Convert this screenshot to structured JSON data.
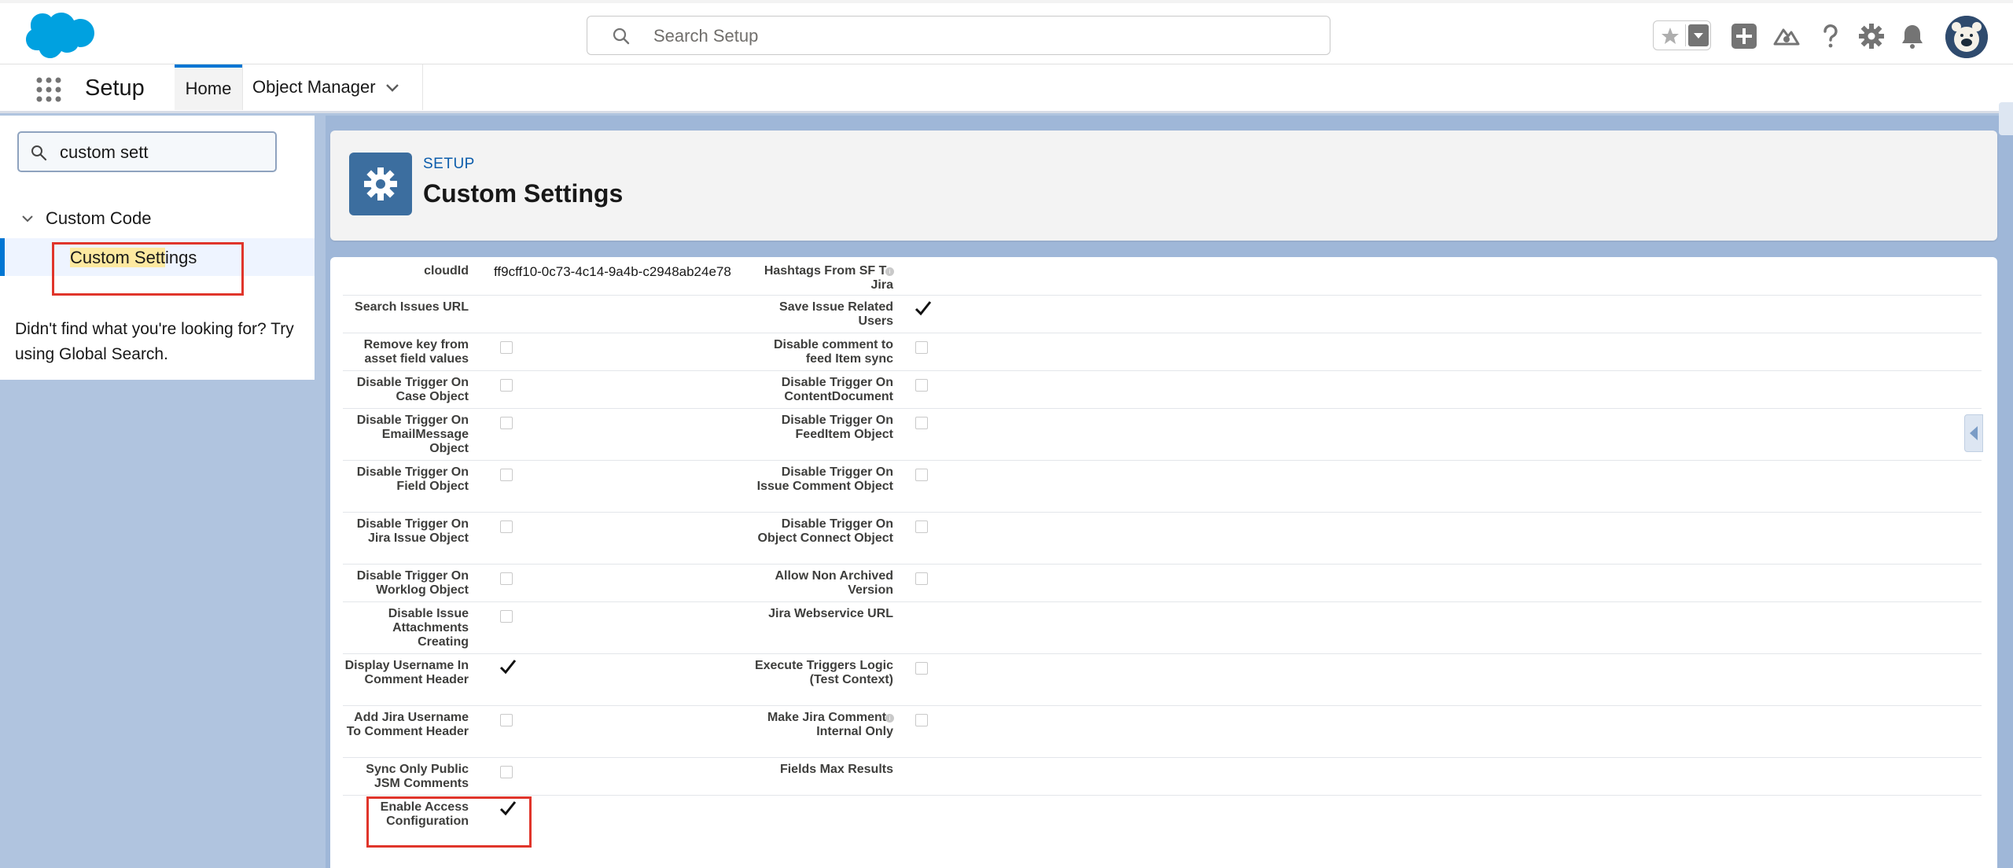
{
  "header": {
    "search_placeholder": "Search Setup",
    "icons": [
      "favorites-star-icon",
      "favorites-dropdown-icon",
      "global-actions-add-icon",
      "trailhead-guidance-icon",
      "help-icon",
      "setup-gear-icon",
      "notifications-bell-icon",
      "user-avatar"
    ]
  },
  "nav": {
    "app_name": "Setup",
    "tabs": [
      {
        "label": "Home"
      },
      {
        "label": "Object Manager"
      }
    ]
  },
  "sidebar": {
    "quickfind_value": "custom sett",
    "tree_parent": "Custom Code",
    "tree_child_match": "Custom Sett",
    "tree_child_rest": "ings",
    "not_found": "Didn't find what you're looking for? Try using Global Search."
  },
  "page_header": {
    "eyebrow": "SETUP",
    "title": "Custom Settings"
  },
  "fields": {
    "r1": {
      "left_label": "cloudId",
      "left_value": "ff9cff10-0c73-4c14-9a4b-c2948ab24e78",
      "right_label": "Hashtags From SF To Jira",
      "right_checked": false
    },
    "r2": {
      "left_label": "Search Issues URL",
      "right_label": "Save Issue Related Users",
      "right_checked": true
    },
    "r3": {
      "left_label": "Remove key from asset field values",
      "left_checked": false,
      "right_label": "Disable comment to feed Item sync",
      "right_checked": false
    },
    "r4": {
      "left_label": "Disable Trigger On Case Object",
      "left_checked": false,
      "right_label": "Disable Trigger On ContentDocument",
      "right_checked": false
    },
    "r5": {
      "left_label": "Disable Trigger On EmailMessage Object",
      "left_checked": false,
      "right_label": "Disable Trigger On FeedItem Object",
      "right_checked": false
    },
    "r6": {
      "left_label": "Disable Trigger On Field Object",
      "left_checked": false,
      "right_label": "Disable Trigger On Issue Comment Object",
      "right_checked": false
    },
    "r7": {
      "left_label": "Disable Trigger On Jira Issue Object",
      "left_checked": false,
      "right_label": "Disable Trigger On Object Connect Object",
      "right_checked": false
    },
    "r8": {
      "left_label": "Disable Trigger On Worklog Object",
      "left_checked": false,
      "right_label": "Allow Non Archived Version",
      "right_checked": false
    },
    "r9": {
      "left_label": "Disable Issue Attachments Creating",
      "left_checked": false,
      "right_label": "Jira Webservice URL"
    },
    "r10": {
      "left_label": "Display Username In Comment Header",
      "left_checked": true,
      "right_label": "Execute Triggers Logic (Test Context)",
      "right_checked": false
    },
    "r11": {
      "left_label": "Add Jira Username To Comment Header",
      "left_checked": false,
      "right_label": "Make Jira Comments Internal Only",
      "right_checked": false
    },
    "r12": {
      "left_label": "Sync Only Public JSM Comments",
      "left_checked": false,
      "right_label": "Fields Max Results"
    },
    "r13": {
      "left_label": "Enable Access Configuration",
      "left_checked": true
    }
  },
  "colors": {
    "brand_blue": "#0176d3",
    "highlight_red": "#e0352b",
    "gear_tile": "#3c6e9f",
    "background": "#b0c4df"
  }
}
